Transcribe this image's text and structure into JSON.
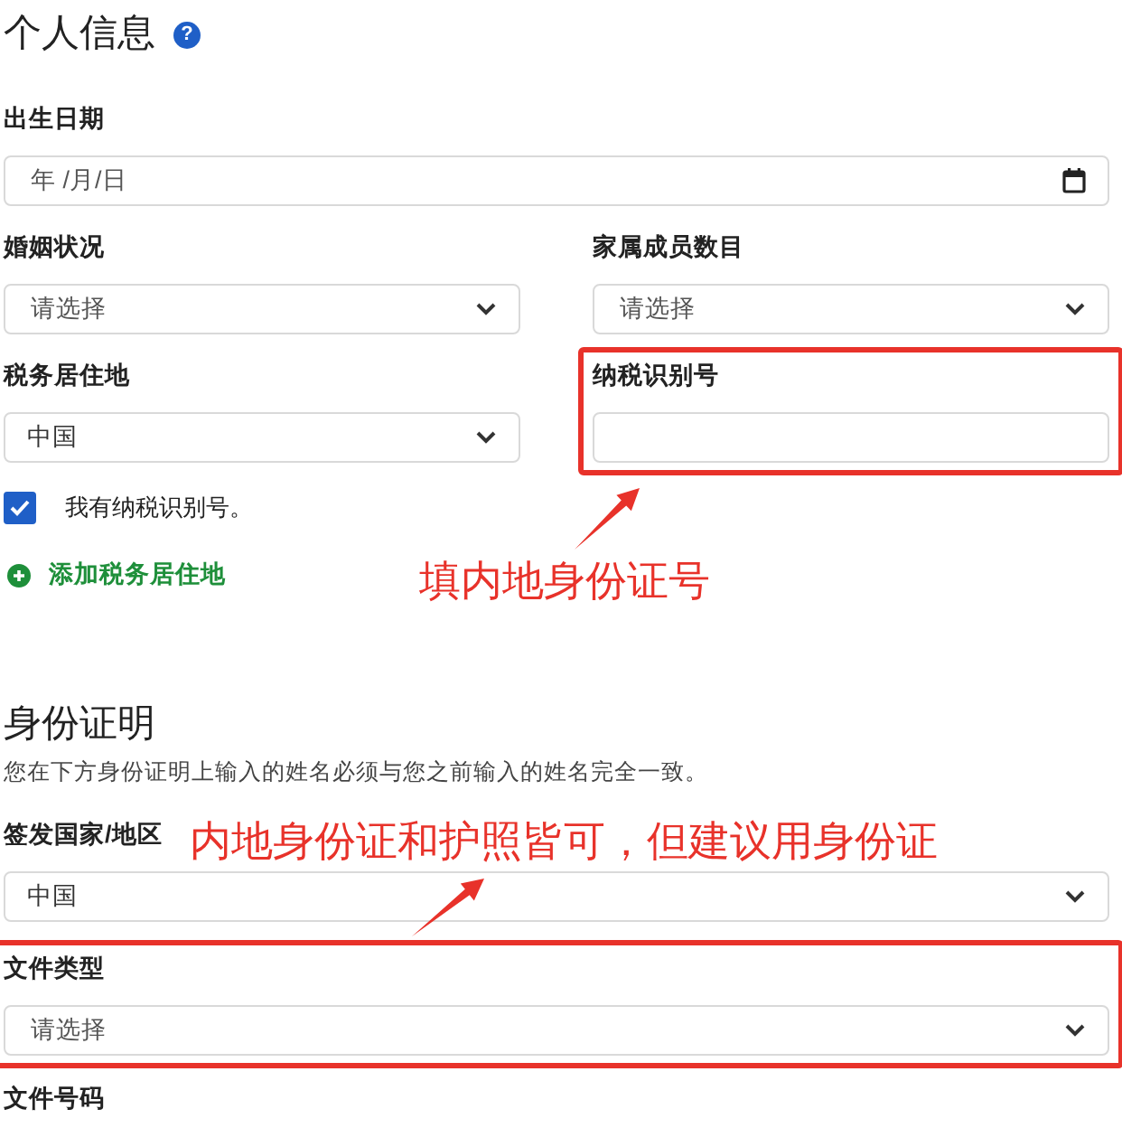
{
  "sections": [
    {
      "title": "个人信息",
      "help_icon": "?",
      "rows": [
        [
          {
            "kind": "date",
            "label": "出生日期",
            "placeholder": "年 /月/日",
            "highlighted": false
          }
        ],
        [
          {
            "kind": "select",
            "label": "婚姻状况",
            "placeholder": "请选择",
            "highlighted": false
          },
          {
            "kind": "select",
            "label": "家属成员数目",
            "placeholder": "请选择",
            "highlighted": false
          }
        ],
        [
          {
            "kind": "select",
            "label": "税务居住地",
            "value": "中国",
            "highlighted": false
          },
          {
            "kind": "text",
            "label": "纳税识别号",
            "highlighted": true
          }
        ]
      ],
      "checkbox": {
        "label": "我有纳税识别号。",
        "checked": true
      },
      "link": {
        "label": "添加税务居住地"
      }
    },
    {
      "title": "身份证明",
      "description": "您在下方身份证明上输入的姓名必须与您之前输入的姓名完全一致。",
      "rows": [
        [
          {
            "kind": "select",
            "label": "签发国家/地区",
            "value": "中国",
            "highlighted": false
          }
        ],
        [
          {
            "kind": "select",
            "label": "文件类型",
            "placeholder": "请选择",
            "highlighted": true
          }
        ],
        [
          {
            "kind": "label",
            "label": "文件号码",
            "highlighted": false
          }
        ]
      ]
    }
  ],
  "annotations": [
    {
      "text": "填内地身份证号"
    },
    {
      "text": "内地身份证和护照皆可，但建议用身份证"
    }
  ]
}
